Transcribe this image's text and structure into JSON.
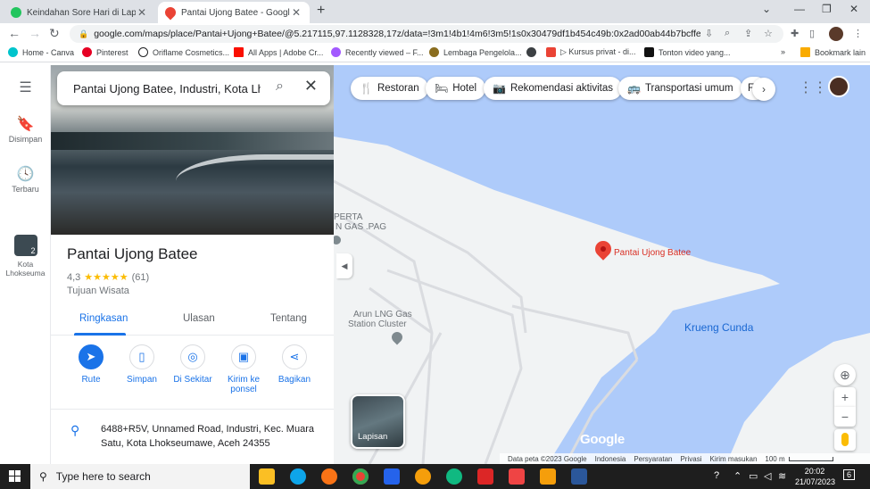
{
  "browser": {
    "tabs": [
      {
        "title": "Keindahan Sore Hari di Lapangan",
        "favicon_color": "#22c55e"
      },
      {
        "title": "Pantai Ujong Batee - Google Maps",
        "favicon_color": "#ea4335"
      }
    ],
    "url": "google.com/maps/place/Pantai+Ujong+Batee/@5.217115,97.1128328,17z/data=!3m1!4b1!4m6!3m5!1s0x30479df1b454c49b:0x2ad00ab44b7bcffe!8m2!...",
    "bookmarks": [
      {
        "label": "Home - Canva",
        "color": "#00c4cc"
      },
      {
        "label": "Pinterest",
        "color": "#e60023"
      },
      {
        "label": "Oriflame Cosmetics...",
        "color": "#202124"
      },
      {
        "label": "All Apps | Adobe Cr...",
        "color": "#fa0f00"
      },
      {
        "label": "Recently viewed – F...",
        "color": "#a259ff"
      },
      {
        "label": "Lembaga Pengelola...",
        "color": "#8a6d1f"
      },
      {
        "label": "",
        "color": "#3c4043"
      },
      {
        "label": "▷ Kursus privat - di...",
        "color": "#ea4335"
      },
      {
        "label": "Tonton video yang...",
        "color": "#111111"
      }
    ],
    "bookmarks_other": "Bookmark lain"
  },
  "rail": {
    "saved": "Disimpan",
    "recent": "Terbaru",
    "recent_place": "Kota Lhokseuma",
    "recent_count": "2"
  },
  "search": {
    "value": "Pantai Ujong Batee, Industri, Kota Lhok"
  },
  "place": {
    "name": "Pantai Ujong Batee",
    "rating": "4,3",
    "stars": "★★★★★",
    "reviews": "(61)",
    "category": "Tujuan Wisata",
    "tabs": [
      "Ringkasan",
      "Ulasan",
      "Tentang"
    ],
    "actions": [
      "Rute",
      "Simpan",
      "Di Sekitar",
      "Kirim ke ponsel",
      "Bagikan"
    ],
    "address": "6488+R5V, Unnamed Road, Industri, Kec. Muara Satu, Kota Lhokseumawe, Aceh 24355"
  },
  "map": {
    "chips": [
      "Restoran",
      "Hotel",
      "Rekomendasi aktivitas",
      "Transportasi umum",
      "F"
    ],
    "pin_label": "Pantai Ujong Batee",
    "water_label": "Krueng Cunda",
    "poi_partial": [
      "PERTA",
      "N GAS .PAG"
    ],
    "poi_gas": [
      "Arun LNG Gas",
      "Station Cluster"
    ],
    "layers_label": "Lapisan",
    "logo": "Google",
    "footer": {
      "data": "Data peta ©2023 Google",
      "country": "Indonesia",
      "terms": "Persyaratan",
      "privacy": "Privasi",
      "feedback": "Kirim masukan",
      "scale": "100 m"
    },
    "colors": {
      "water": "#aecbfa",
      "land": "#f1f3f4",
      "pin": "#ea4335"
    }
  },
  "taskbar": {
    "search_placeholder": "Type here to search",
    "time": "20:02",
    "date": "21/07/2023",
    "notification_count": "6"
  }
}
